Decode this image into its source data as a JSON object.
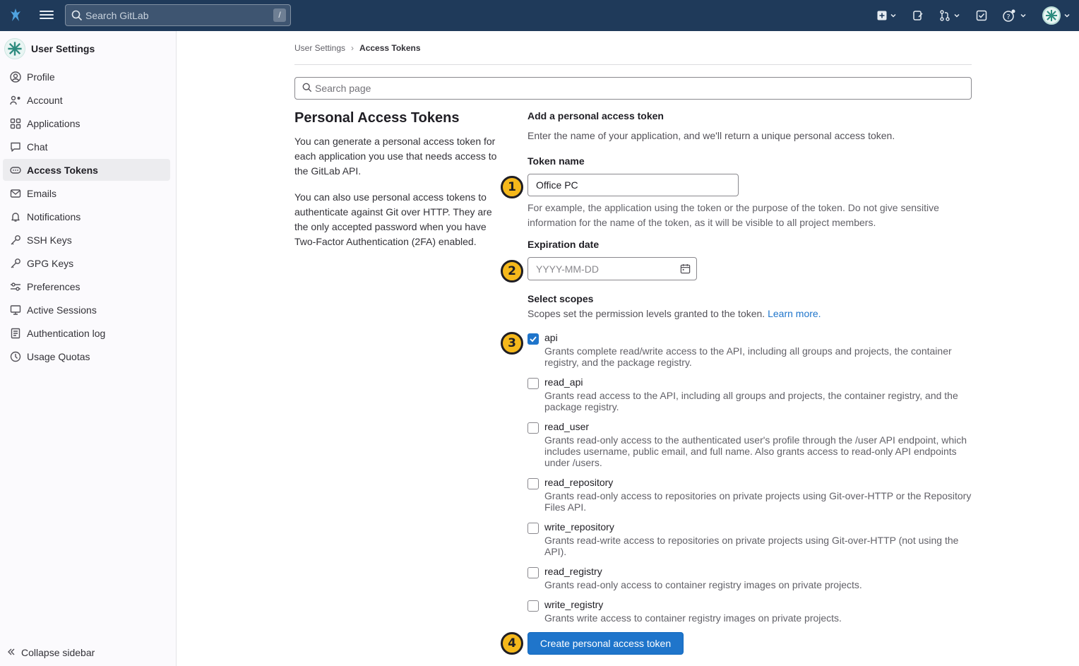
{
  "topbar": {
    "search_placeholder": "Search GitLab",
    "search_shortcut": "/"
  },
  "sidebar": {
    "title": "User Settings",
    "items": [
      {
        "label": "Profile",
        "icon": "profile-icon"
      },
      {
        "label": "Account",
        "icon": "account-icon"
      },
      {
        "label": "Applications",
        "icon": "applications-icon"
      },
      {
        "label": "Chat",
        "icon": "chat-icon"
      },
      {
        "label": "Access Tokens",
        "icon": "token-icon",
        "active": true
      },
      {
        "label": "Emails",
        "icon": "mail-icon"
      },
      {
        "label": "Notifications",
        "icon": "bell-icon"
      },
      {
        "label": "SSH Keys",
        "icon": "key-icon"
      },
      {
        "label": "GPG Keys",
        "icon": "key-icon"
      },
      {
        "label": "Preferences",
        "icon": "preferences-icon"
      },
      {
        "label": "Active Sessions",
        "icon": "monitor-icon"
      },
      {
        "label": "Authentication log",
        "icon": "log-icon"
      },
      {
        "label": "Usage Quotas",
        "icon": "quota-icon"
      }
    ],
    "collapse_label": "Collapse sidebar"
  },
  "breadcrumb": {
    "parent": "User Settings",
    "separator": "›",
    "current": "Access Tokens"
  },
  "page_search": {
    "placeholder": "Search page"
  },
  "intro": {
    "title": "Personal Access Tokens",
    "p1": "You can generate a personal access token for each application you use that needs access to the GitLab API.",
    "p2": "You can also use personal access tokens to authenticate against Git over HTTP. They are the only accepted password when you have Two-Factor Authentication (2FA) enabled."
  },
  "form": {
    "heading": "Add a personal access token",
    "subheading": "Enter the name of your application, and we'll return a unique personal access token.",
    "token_name_label": "Token name",
    "token_name_value": "Office PC",
    "token_name_help": "For example, the application using the token or the purpose of the token. Do not give sensitive information for the name of the token, as it will be visible to all project members.",
    "expiration_label": "Expiration date",
    "expiration_placeholder": "YYYY-MM-DD",
    "scopes_label": "Select scopes",
    "scopes_help": "Scopes set the permission levels granted to the token.",
    "scopes_link": "Learn more.",
    "scopes": [
      {
        "name": "api",
        "checked": true,
        "desc": "Grants complete read/write access to the API, including all groups and projects, the container registry, and the package registry."
      },
      {
        "name": "read_api",
        "checked": false,
        "desc": "Grants read access to the API, including all groups and projects, the container registry, and the package registry."
      },
      {
        "name": "read_user",
        "checked": false,
        "desc": "Grants read-only access to the authenticated user's profile through the /user API endpoint, which includes username, public email, and full name. Also grants access to read-only API endpoints under /users."
      },
      {
        "name": "read_repository",
        "checked": false,
        "desc": "Grants read-only access to repositories on private projects using Git-over-HTTP or the Repository Files API."
      },
      {
        "name": "write_repository",
        "checked": false,
        "desc": "Grants read-write access to repositories on private projects using Git-over-HTTP (not using the API)."
      },
      {
        "name": "read_registry",
        "checked": false,
        "desc": "Grants read-only access to container registry images on private projects."
      },
      {
        "name": "write_registry",
        "checked": false,
        "desc": "Grants write access to container registry images on private projects."
      }
    ],
    "submit_label": "Create personal access token"
  },
  "steps": [
    "1",
    "2",
    "3",
    "4"
  ],
  "colors": {
    "topbar": "#1f3a5a",
    "primary": "#1f75cb",
    "step_badge": "#f5b81b"
  }
}
